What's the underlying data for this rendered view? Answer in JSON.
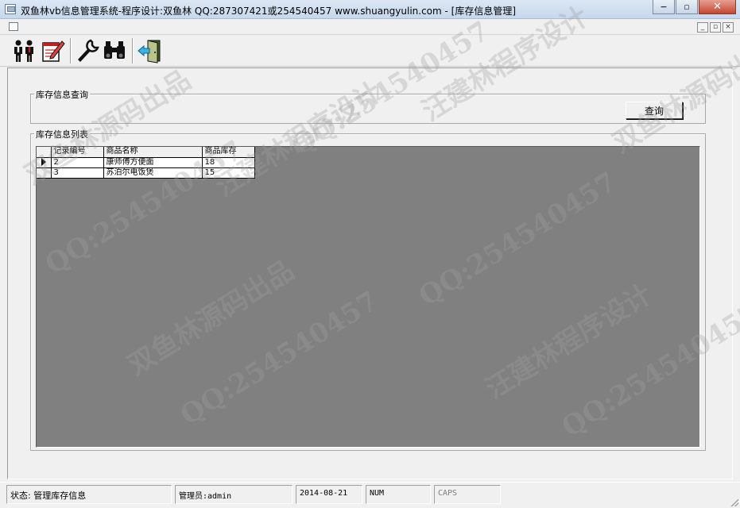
{
  "window": {
    "title": "双鱼林vb信息管理系统-程序设计:双鱼林 QQ:287307421或254540457 www.shuangyulin.com - [库存信息管理]",
    "minimize_symbol": "−",
    "restore_symbol": "▫",
    "close_symbol": "✕"
  },
  "mdi_controls": {
    "minimize": "_",
    "restore": "▫",
    "close": "×"
  },
  "toolbar": {
    "tools": [
      {
        "icon": "users-icon"
      },
      {
        "icon": "notepad-edit-icon"
      },
      {
        "icon": "wrench-icon"
      },
      {
        "icon": "binoculars-icon"
      },
      {
        "icon": "exit-door-icon"
      }
    ]
  },
  "query_frame": {
    "legend": "库存信息查询",
    "query_button": "查询"
  },
  "list_frame": {
    "legend": "库存信息列表",
    "columns": [
      "记录编号",
      "商品名称",
      "商品库存"
    ],
    "rows": [
      {
        "id": "2",
        "name": "康师傅方便面",
        "stock": "18",
        "current": true
      },
      {
        "id": "3",
        "name": "苏泊尔电饭煲",
        "stock": "15",
        "current": false
      }
    ]
  },
  "statusbar": {
    "status": "状态: 管理库存信息",
    "admin": "管理员:admin",
    "date": "2014-08-21",
    "num": "NUM",
    "caps": "CAPS"
  },
  "watermarks": [
    "汪建林程序设计",
    "QQ:254540457",
    "双鱼林源码出品"
  ]
}
